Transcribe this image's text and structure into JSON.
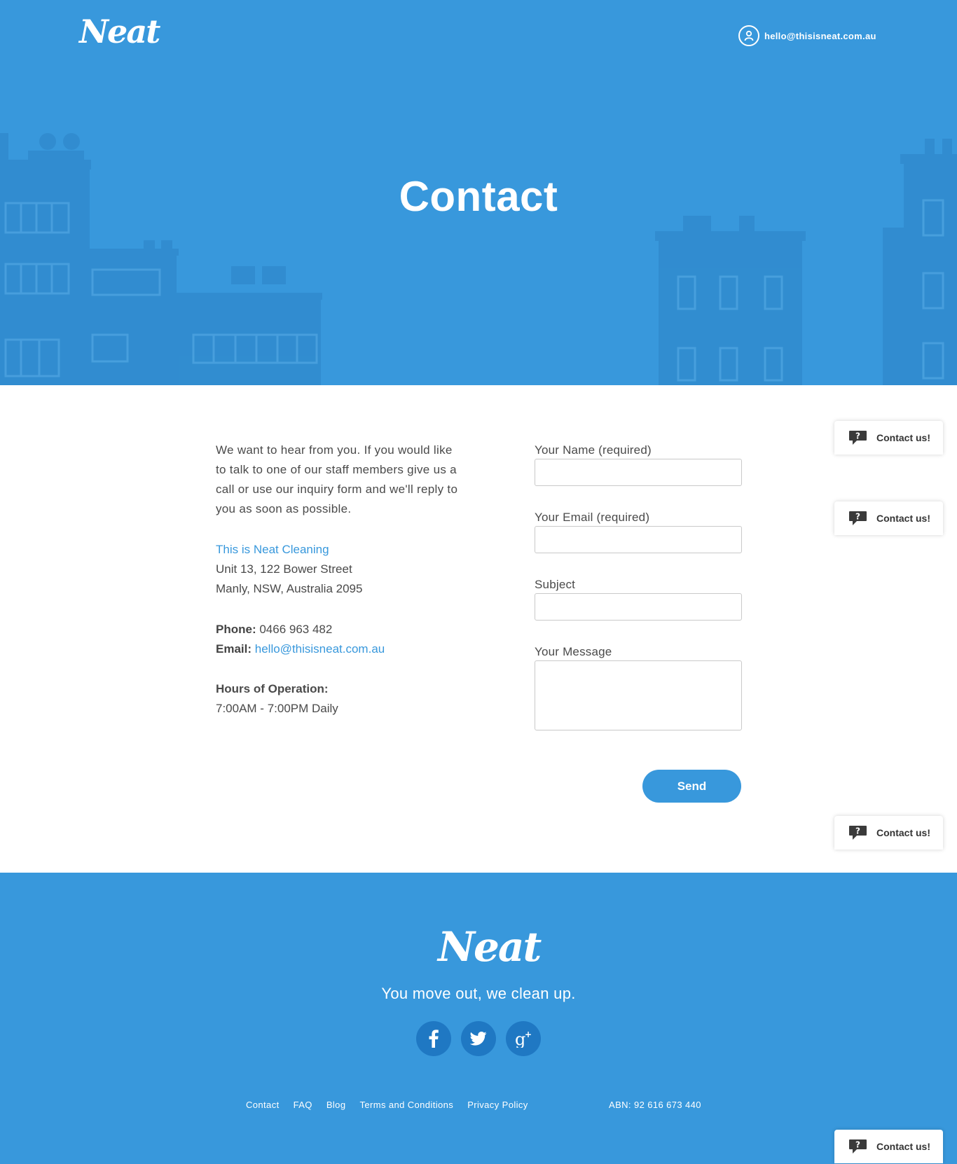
{
  "header": {
    "logo_text": "Neat",
    "email": "hello@thisisneat.com.au"
  },
  "hero": {
    "title": "Contact"
  },
  "intro": {
    "text": "We want to hear from you. If you would like to talk to one of our staff members give us a call or use our inquiry form and we'll reply to you as soon as possible."
  },
  "company": {
    "name": "This is Neat Cleaning",
    "address_line1": "Unit 13, 122 Bower Street",
    "address_line2": "Manly, NSW, Australia 2095",
    "phone_label": "Phone:",
    "phone": "0466 963 482",
    "email_label": "Email:",
    "email": "hello@thisisneat.com.au",
    "hours_label": "Hours of Operation:",
    "hours": "7:00AM - 7:00PM Daily"
  },
  "form": {
    "name_label": "Your Name (required)",
    "email_label": "Your Email (required)",
    "subject_label": "Subject",
    "message_label": "Your Message",
    "name_value": "",
    "email_value": "",
    "subject_value": "",
    "message_value": "",
    "send_label": "Send"
  },
  "contact_widget": {
    "label": "Contact us!"
  },
  "footer": {
    "logo_text": "Neat",
    "tagline": "You move out, we clean up.",
    "social": [
      "facebook-icon",
      "twitter-icon",
      "google-plus-icon"
    ],
    "nav": [
      "Contact",
      "FAQ",
      "Blog",
      "Terms and Conditions",
      "Privacy Policy"
    ],
    "abn": "ABN: 92 616 673 440"
  },
  "colors": {
    "brand_blue": "#3898dc",
    "social_blue": "#1f78c3"
  }
}
